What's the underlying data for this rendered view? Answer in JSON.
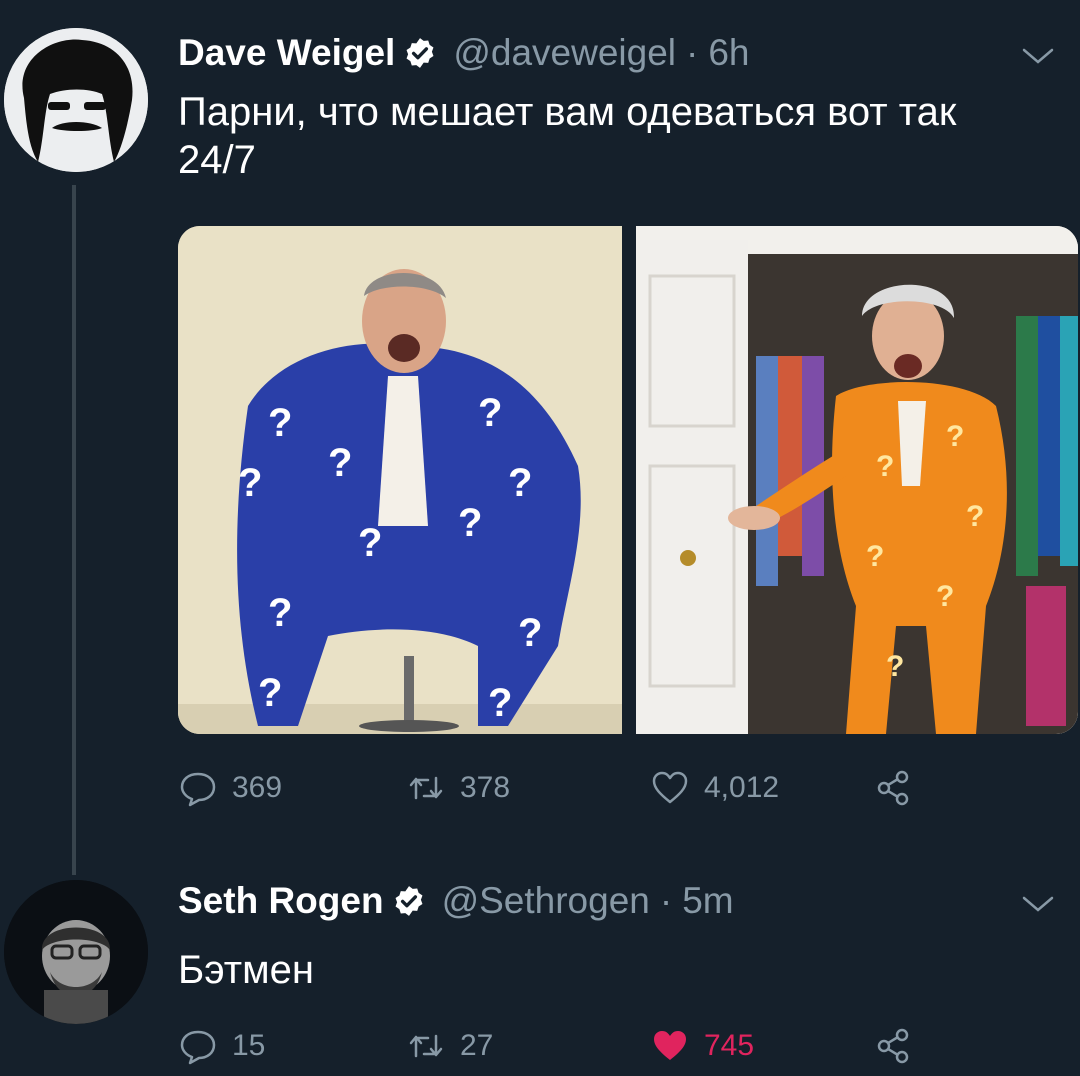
{
  "tweets": [
    {
      "name": "Dave Weigel",
      "handle": "@daveweigel",
      "separator": "·",
      "time": "6h",
      "text": "Парни, что мешает вам одеваться вот так 24/7",
      "stats": {
        "replies": "369",
        "retweets": "378",
        "likes": "4,012"
      },
      "liked": false
    },
    {
      "name": "Seth Rogen",
      "handle": "@Sethrogen",
      "separator": "·",
      "time": "5m",
      "text": "Бэтмен",
      "stats": {
        "replies": "15",
        "retweets": "27",
        "likes": "745"
      },
      "liked": true
    }
  ],
  "colors": {
    "background": "#15202b",
    "secondary_text": "#8899a6",
    "verified": "#ffffff",
    "like_active": "#e0245e",
    "thread_line": "#38444d"
  }
}
